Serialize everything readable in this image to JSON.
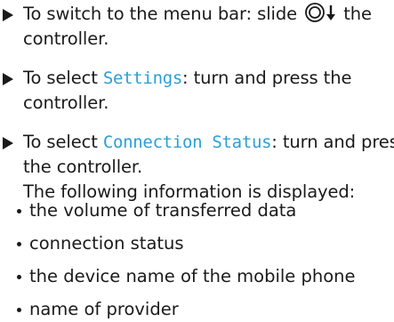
{
  "steps": [
    {
      "prefix": "To switch to the menu bar: slide ",
      "icon": "controller-slide-down-icon",
      "suffix": " the controller."
    },
    {
      "prefix": "To select ",
      "highlight": "Settings",
      "suffix": ": turn and press the controller."
    },
    {
      "prefix": "To select ",
      "highlight": "Connection Status",
      "suffix": ": turn and press the controller.",
      "info": "The following information is displayed:"
    }
  ],
  "info_items": [
    "the volume of transferred data",
    "connection status",
    "the device name of the mobile phone",
    "name of provider"
  ],
  "colors": {
    "highlight": "#2a9fd6",
    "text": "#1a1a1a"
  }
}
